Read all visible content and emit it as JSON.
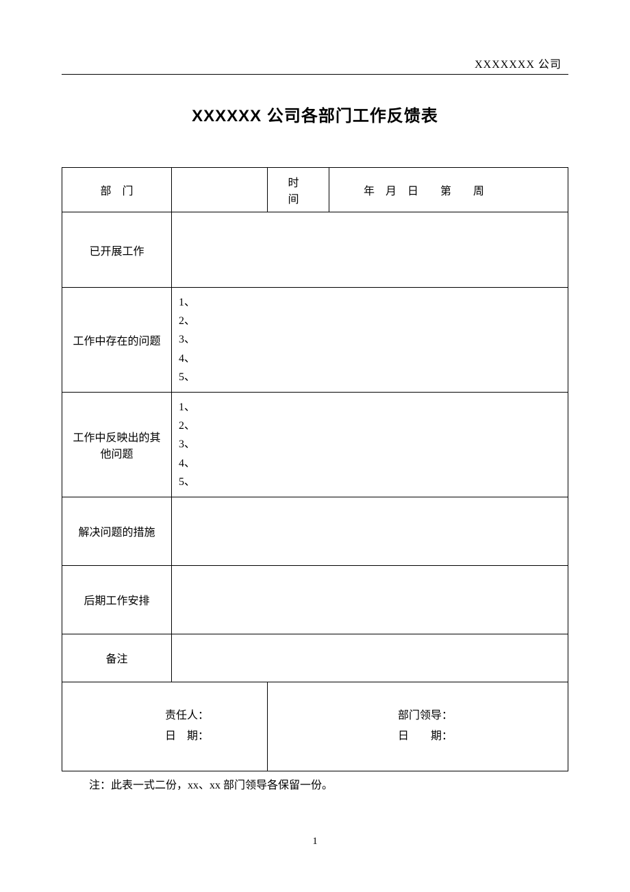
{
  "header": {
    "company": "XXXXXXX 公司"
  },
  "title": "XXXXXX 公司各部门工作反馈表",
  "labels": {
    "department": "部　门",
    "time": "时　间",
    "date_line": "年　月　日　　第　　周",
    "work_done": "已开展工作",
    "issues": "工作中存在的问题",
    "other_issues": "工作中反映出的其他问题",
    "measures": "解决问题的措施",
    "future_plan": "后期工作安排",
    "remarks": "备注"
  },
  "issues_list": [
    "1、",
    "2、",
    "3、",
    "4、",
    "5、"
  ],
  "other_issues_list": [
    "1、",
    "2、",
    "3、",
    "4、",
    "5、"
  ],
  "signatures": {
    "responsible_label": "责任人：",
    "date_label_l": "日　期：",
    "leader_label": "部门领导：",
    "date_label_r": "日　　期："
  },
  "footnote": "注：此表一式二份，xx、xx 部门领导各保留一份。",
  "page_number": "1"
}
